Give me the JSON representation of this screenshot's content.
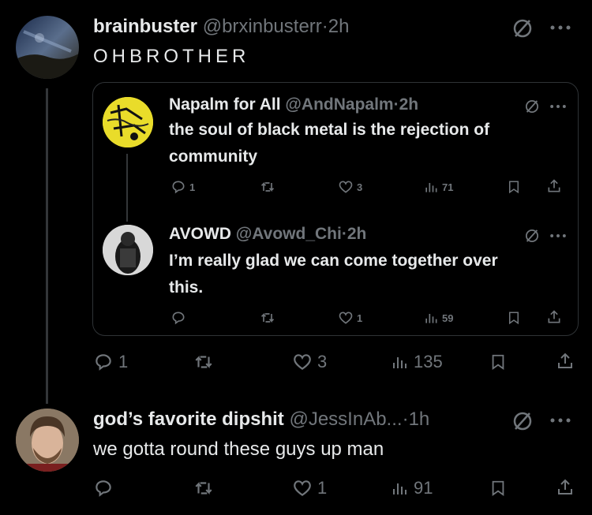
{
  "main_post": {
    "display_name": "brainbuster",
    "handle": "@brxinbusterr",
    "time": "2h",
    "text": "OHBROTHER",
    "actions": {
      "replies": "1",
      "reposts": "",
      "likes": "3",
      "views": "135"
    }
  },
  "quoted": {
    "post1": {
      "display_name": "Napalm for All",
      "handle": "@AndNapalm",
      "time": "2h",
      "text_line1": "the soul of black metal is the rejection of",
      "text_line2": "community",
      "actions": {
        "replies": "1",
        "reposts": "",
        "likes": "3",
        "views": "71"
      }
    },
    "post2": {
      "display_name": "AVOWD",
      "handle": "@Avowd_Chi",
      "time": "2h",
      "text_line1": "I’m really glad we can come together over",
      "text_line2": "this.",
      "actions": {
        "replies": "",
        "reposts": "",
        "likes": "1",
        "views": "59"
      }
    }
  },
  "reply_post": {
    "display_name": "god’s favorite dipshit",
    "handle": "@JessInAb...",
    "time": "1h",
    "text": "we gotta round these guys up man",
    "actions": {
      "replies": "",
      "reposts": "",
      "likes": "1",
      "views": "91"
    }
  },
  "separator": "·",
  "colors": {
    "background": "#000000",
    "text": "#e7e9ea",
    "muted": "#71767b",
    "border": "#2f3336"
  }
}
